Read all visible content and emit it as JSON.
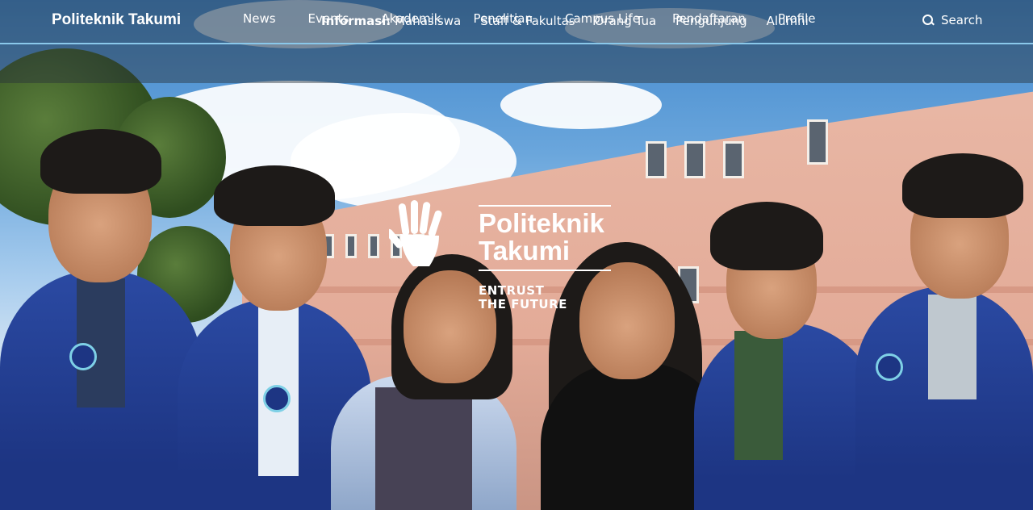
{
  "header": {
    "brand": "Politeknik Takumi",
    "info_label": "Informasi:",
    "info_links": [
      "Mahasiswa",
      "Staff & Fakultas",
      "Orang Tua",
      "Pengunjung",
      "Alumni"
    ],
    "search_label": "Search",
    "search_icon": "search-icon"
  },
  "main_nav": {
    "items": [
      "News",
      "Events",
      "Akademik",
      "Penelitian",
      "Campus Life",
      "Pendaftaran",
      "Profile"
    ]
  },
  "hero": {
    "logo_title_line1": "Politeknik",
    "logo_title_line2": "Takumi",
    "tagline_line1": "ENTRUST",
    "tagline_line2": "THE FUTURE",
    "logo_icon": "raised-hand-icon"
  },
  "colors": {
    "nav_overlay": "#28303a",
    "divider": "#8ac8ea",
    "jacket": "#1d3583",
    "building": "#e3ab98"
  }
}
